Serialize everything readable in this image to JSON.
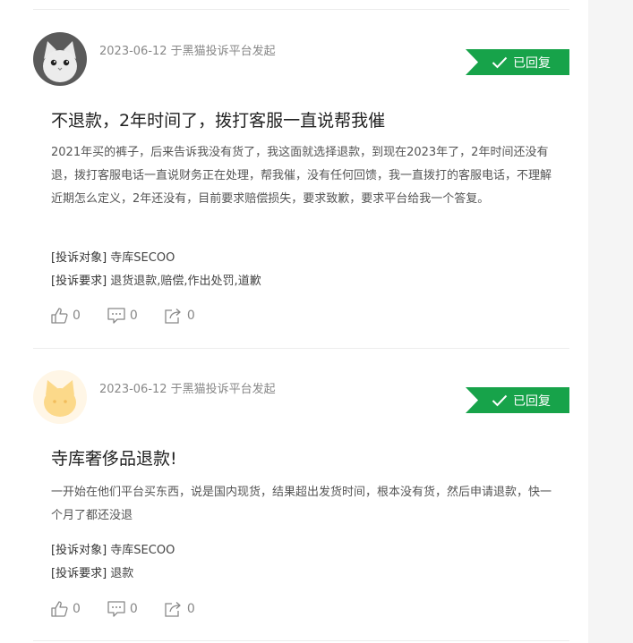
{
  "complaints": [
    {
      "meta": "2023-06-12 于黑猫投诉平台发起",
      "badge": "已回复",
      "title": "不退款，2年时间了，拨打客服一直说帮我催",
      "description": "2021年买的裤子，后来告诉我没有货了，我这面就选择退款，到现在2023年了，2年时间还没有退，拨打客服电话一直说财务正在处理，帮我催，没有任何回馈，我一直拨打的客服电话，不理解近期怎么定义，2年还没有，目前要求赔偿损失，要求致歉，要求平台给我一个答复。",
      "target_label": "[投诉对象]",
      "target": "寺库SECOO",
      "demand_label": "[投诉要求]",
      "demand": "退货退款,赔偿,作出处罚,道歉",
      "likes": "0",
      "comments": "0",
      "shares": "0"
    },
    {
      "meta": "2023-06-12 于黑猫投诉平台发起",
      "badge": "已回复",
      "title": "寺库奢侈品退款!",
      "description": "一开始在他们平台买东西，说是国内现货，结果超出发货时间，根本没有货，然后申请退款，快一个月了都还没退",
      "target_label": "[投诉对象]",
      "target": "寺库SECOO",
      "demand_label": "[投诉要求]",
      "demand": "退款",
      "likes": "0",
      "comments": "0",
      "shares": "0"
    }
  ],
  "colors": {
    "badge": "#17a34a",
    "panel": "#ffffff",
    "side": "#f5f5f5"
  },
  "icons": [
    "avatar-cat-grey",
    "avatar-cat-yellow",
    "check-icon",
    "thumbs-up-icon",
    "comment-icon",
    "share-icon"
  ]
}
